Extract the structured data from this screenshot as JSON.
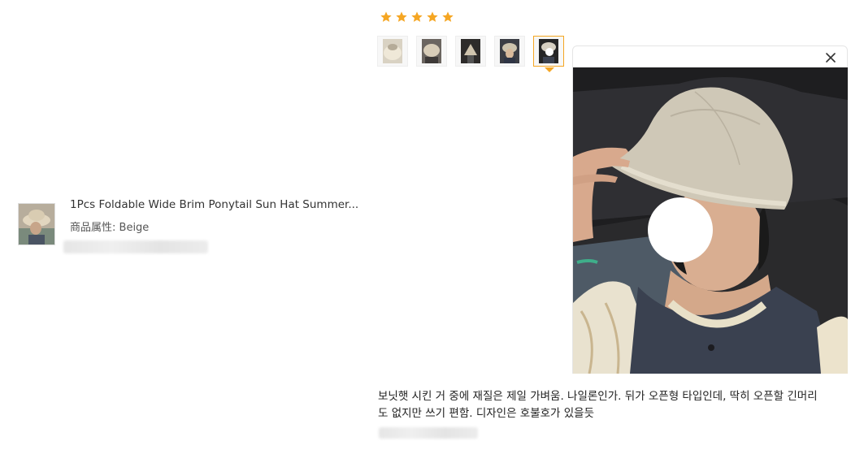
{
  "rating": {
    "stars": 5,
    "max": 5
  },
  "product": {
    "title": "1Pcs Foldable Wide Brim Ponytail Sun Hat Summer...",
    "attr_label": "商品属性:",
    "attr_value": "Beige"
  },
  "review": {
    "thumbnail_count": 5,
    "active_index": 4,
    "text_line1": "보닛햇 시킨 거 중에 재질은 제일 가벼움. 나일론인가. 뒤가 오픈형 타입인데, 딱히 오픈할 긴머리",
    "text_line2": "도 없지만 쓰기 편함. 디자인은 호불호가 있을듯"
  },
  "icons": {
    "star": "star-icon",
    "close": "close-icon"
  },
  "colors": {
    "star": "#f5a623",
    "active_border": "#f5a623"
  }
}
